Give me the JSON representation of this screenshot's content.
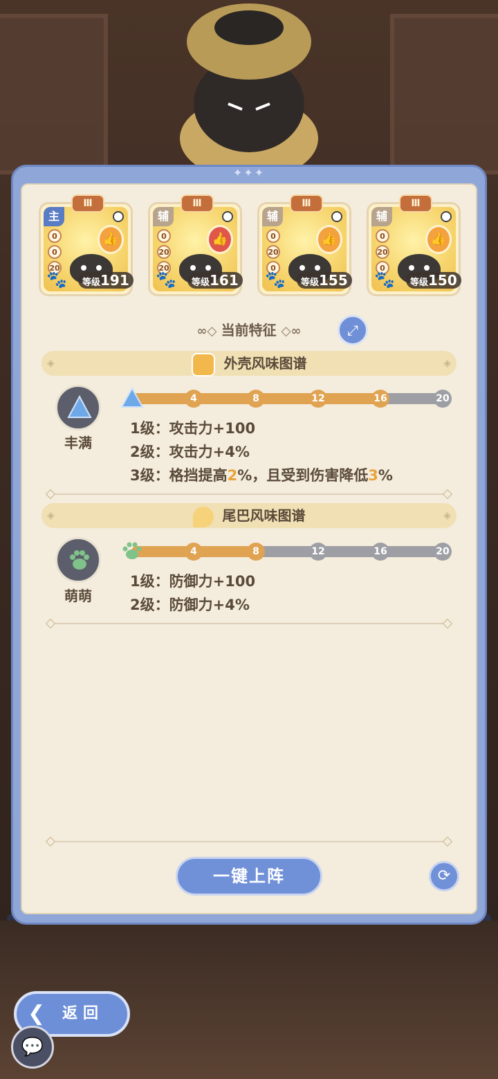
{
  "cards": [
    {
      "role": "主",
      "rank": "Ⅲ",
      "stats": [
        "0",
        "0",
        "20"
      ],
      "level_label": "等级",
      "level": "191",
      "badge_color": "#f3a23f"
    },
    {
      "role": "辅",
      "rank": "Ⅲ",
      "stats": [
        "0",
        "20",
        "20"
      ],
      "level_label": "等级",
      "level": "161",
      "badge_color": "#e0564b"
    },
    {
      "role": "辅",
      "rank": "Ⅲ",
      "stats": [
        "0",
        "20",
        "0"
      ],
      "level_label": "等级",
      "level": "155",
      "badge_color": "#f3a23f"
    },
    {
      "role": "辅",
      "rank": "Ⅲ",
      "stats": [
        "0",
        "20",
        "0"
      ],
      "level_label": "等级",
      "level": "150",
      "badge_color": "#f3a23f"
    }
  ],
  "traits_title": "当前特征",
  "sections": [
    {
      "band_title": "外壳风味图谱",
      "trait_name": "丰满",
      "ticks": [
        "4",
        "8",
        "12",
        "16",
        "20"
      ],
      "progress": 0.8,
      "lines": [
        {
          "prefix": "1级：",
          "text": "攻击力+100"
        },
        {
          "prefix": "2级：",
          "text": "攻击力+4%"
        },
        {
          "prefix": "3级：",
          "text_a": "格挡提高",
          "hl_a": "2",
          "text_b": "%，且受到伤害降低",
          "hl_b": "3",
          "text_c": "%"
        }
      ]
    },
    {
      "band_title": "尾巴风味图谱",
      "trait_name": "萌萌",
      "ticks": [
        "4",
        "8",
        "12",
        "16",
        "20"
      ],
      "progress": 0.4,
      "lines": [
        {
          "prefix": "1级：",
          "text": "防御力+100"
        },
        {
          "prefix": "2级：",
          "text": "防御力+4%"
        }
      ]
    }
  ],
  "deploy_label": "一键上阵",
  "back_label": "返回",
  "colors": {
    "accent": "#7090d8",
    "fill": "#e0a352",
    "panel": "#f4ecdc"
  }
}
